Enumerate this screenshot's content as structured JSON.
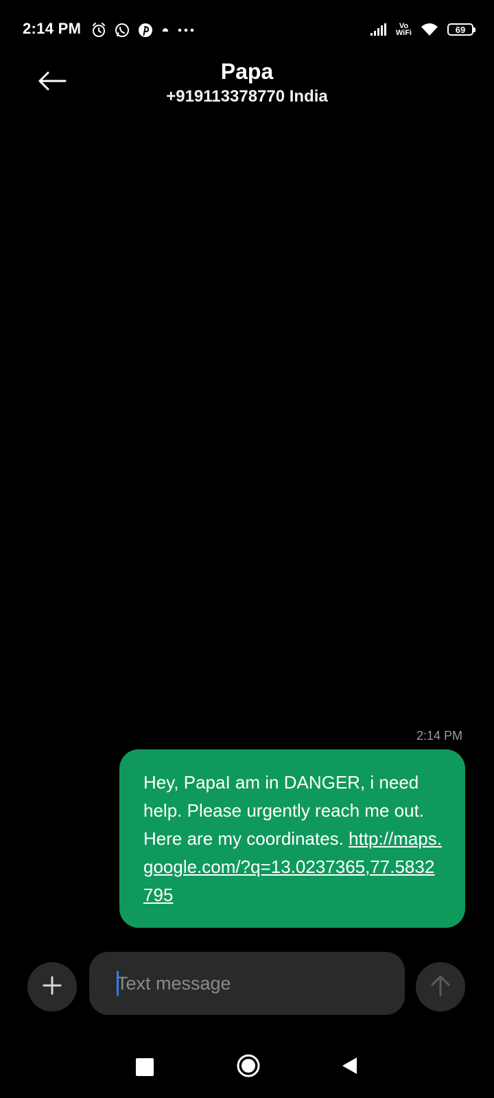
{
  "status_bar": {
    "time": "2:14 PM",
    "left_icons": [
      "alarm-icon",
      "whatsapp-icon",
      "pinterest-icon",
      "notification-dot-icon",
      "more-notifications-icon"
    ],
    "vowifi_line1": "Vo",
    "vowifi_line2": "WiFi",
    "battery_level": "69"
  },
  "header": {
    "contact_name": "Papa",
    "contact_number": "+919113378770 India",
    "back_icon": "arrow-left-icon"
  },
  "conversation": {
    "messages": [
      {
        "time": "2:14 PM",
        "text": "Hey, PapaI am in DANGER, i need help. Please urgently reach me out. Here are my coordinates.",
        "link": "http://maps.google.com/?q=13.0237365,77.5832795",
        "direction": "outgoing"
      }
    ]
  },
  "composer": {
    "attach_icon": "plus-icon",
    "placeholder": "Text message",
    "value": "",
    "send_icon": "arrow-up-icon"
  },
  "nav_bar": {
    "recents_icon": "square-icon",
    "home_icon": "circle-icon",
    "back_icon": "triangle-back-icon"
  },
  "colors": {
    "background": "#000000",
    "bubble": "#10995c",
    "input_background": "#2a2a2a",
    "caret": "#2f7ef5",
    "timestamp": "#9a9a9a"
  }
}
